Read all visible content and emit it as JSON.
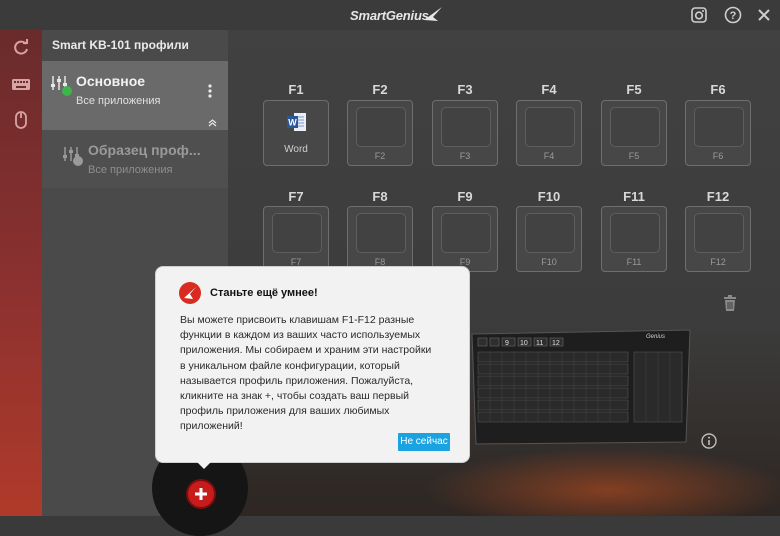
{
  "window": {
    "brand": "SmartGenius"
  },
  "profiles": {
    "title": "Smart KB-101  профили",
    "items": [
      {
        "name": "Основное",
        "subtitle": "Все приложения",
        "status_color": "#3cb64a",
        "active": true
      },
      {
        "name": "Образец проф...",
        "subtitle": "Все приложения",
        "status_color": "#9a9a9a",
        "active": false
      }
    ]
  },
  "fkeys": [
    {
      "label": "F1",
      "caption": "Word",
      "icon": "word-app-icon"
    },
    {
      "label": "F2",
      "caption": "F2"
    },
    {
      "label": "F3",
      "caption": "F3"
    },
    {
      "label": "F4",
      "caption": "F4"
    },
    {
      "label": "F5",
      "caption": "F5"
    },
    {
      "label": "F6",
      "caption": "F6"
    },
    {
      "label": "F7",
      "caption": "F7"
    },
    {
      "label": "F8",
      "caption": "F8"
    },
    {
      "label": "F9",
      "caption": "F9"
    },
    {
      "label": "F10",
      "caption": "F10"
    },
    {
      "label": "F11",
      "caption": "F11"
    },
    {
      "label": "F12",
      "caption": "F12"
    }
  ],
  "keyboard": {
    "brand": "Genius",
    "visible_keys": [
      "9",
      "10",
      "11",
      "12"
    ]
  },
  "popup": {
    "title": "Станьте ещё умнее!",
    "body_lines": [
      "Вы можете присвоить клавишам F1-F12 разные",
      "функции в каждом из ваших часто используемых",
      "приложения. Мы собираем и храним эти настройки",
      "в уникальном файле конфигурации, который",
      "называется профиль приложения. Пожалуйста,",
      "кликните на знак +, чтобы создать ваш первый",
      "профиль приложения для ваших любимых",
      "приложений!"
    ],
    "button": "Не сейчас"
  },
  "colors": {
    "accent_blue": "#1aa3e0",
    "add_button_red": "#c61c1c",
    "active_dot": "#3cb64a"
  }
}
